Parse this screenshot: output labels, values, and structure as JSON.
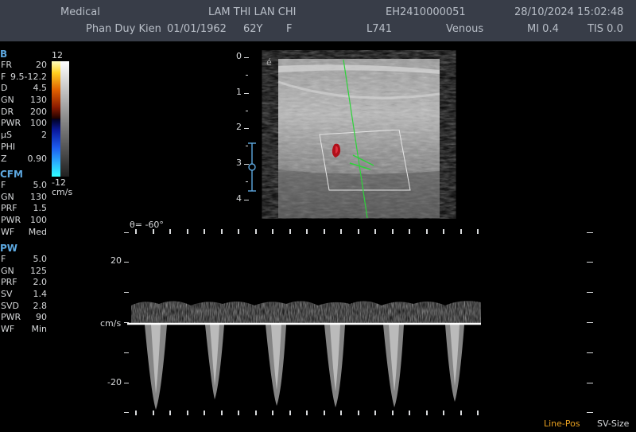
{
  "header": {
    "line1": {
      "institution": "Medical",
      "patient_name": "LAM THI LAN CHI",
      "patient_id": "EH2410000051",
      "datetime": "28/10/2024 15:02:48"
    },
    "line2": {
      "operator": "Phan Duy Kien",
      "birth_date": "01/01/1962",
      "age": "62Y",
      "sex": "F",
      "probe": "L741",
      "preset": "Venous",
      "mi": "MI 0.4",
      "tis": "TIS 0.0"
    }
  },
  "params": {
    "b": {
      "title": "B",
      "rows": [
        {
          "k": "FR",
          "v": "20"
        },
        {
          "k": "F",
          "v": "9.5-12.2"
        },
        {
          "k": "D",
          "v": "4.5"
        },
        {
          "k": "GN",
          "v": "130"
        },
        {
          "k": "DR",
          "v": "200"
        },
        {
          "k": "PWR",
          "v": "100"
        },
        {
          "k": "µS",
          "v": "2"
        },
        {
          "k": "PHI",
          "v": ""
        },
        {
          "k": "Z",
          "v": "0.90"
        }
      ]
    },
    "cfm": {
      "title": "CFM",
      "rows": [
        {
          "k": "F",
          "v": "5.0"
        },
        {
          "k": "GN",
          "v": "130"
        },
        {
          "k": "PRF",
          "v": "1.5"
        },
        {
          "k": "PWR",
          "v": "100"
        },
        {
          "k": "WF",
          "v": "Med"
        }
      ]
    },
    "pw": {
      "title": "PW",
      "rows": [
        {
          "k": "F",
          "v": "5.0"
        },
        {
          "k": "GN",
          "v": "125"
        },
        {
          "k": "PRF",
          "v": "2.0"
        },
        {
          "k": "SV",
          "v": "1.4"
        },
        {
          "k": "SVD",
          "v": "2.8"
        },
        {
          "k": "PWR",
          "v": "90"
        },
        {
          "k": "WF",
          "v": "Min"
        }
      ]
    }
  },
  "colorbar": {
    "top_label": "12",
    "bottom_label": "-12",
    "unit": "cm/s"
  },
  "bmode": {
    "depth_labels": [
      "0",
      "1",
      "2",
      "3",
      "4"
    ],
    "orientation_marker": "é"
  },
  "doppler": {
    "angle_label": "θ= -60°",
    "velocity_labels": [
      "20",
      "cm/s",
      "-20"
    ]
  },
  "softkeys": {
    "line_pos": "Line-Pos",
    "sv_size": "SV-Size"
  },
  "colors": {
    "header_bg": "#383d48",
    "param_title": "#5da8e0",
    "doppler_line": "#2ed33a",
    "softkey_active": "#e8a020"
  }
}
